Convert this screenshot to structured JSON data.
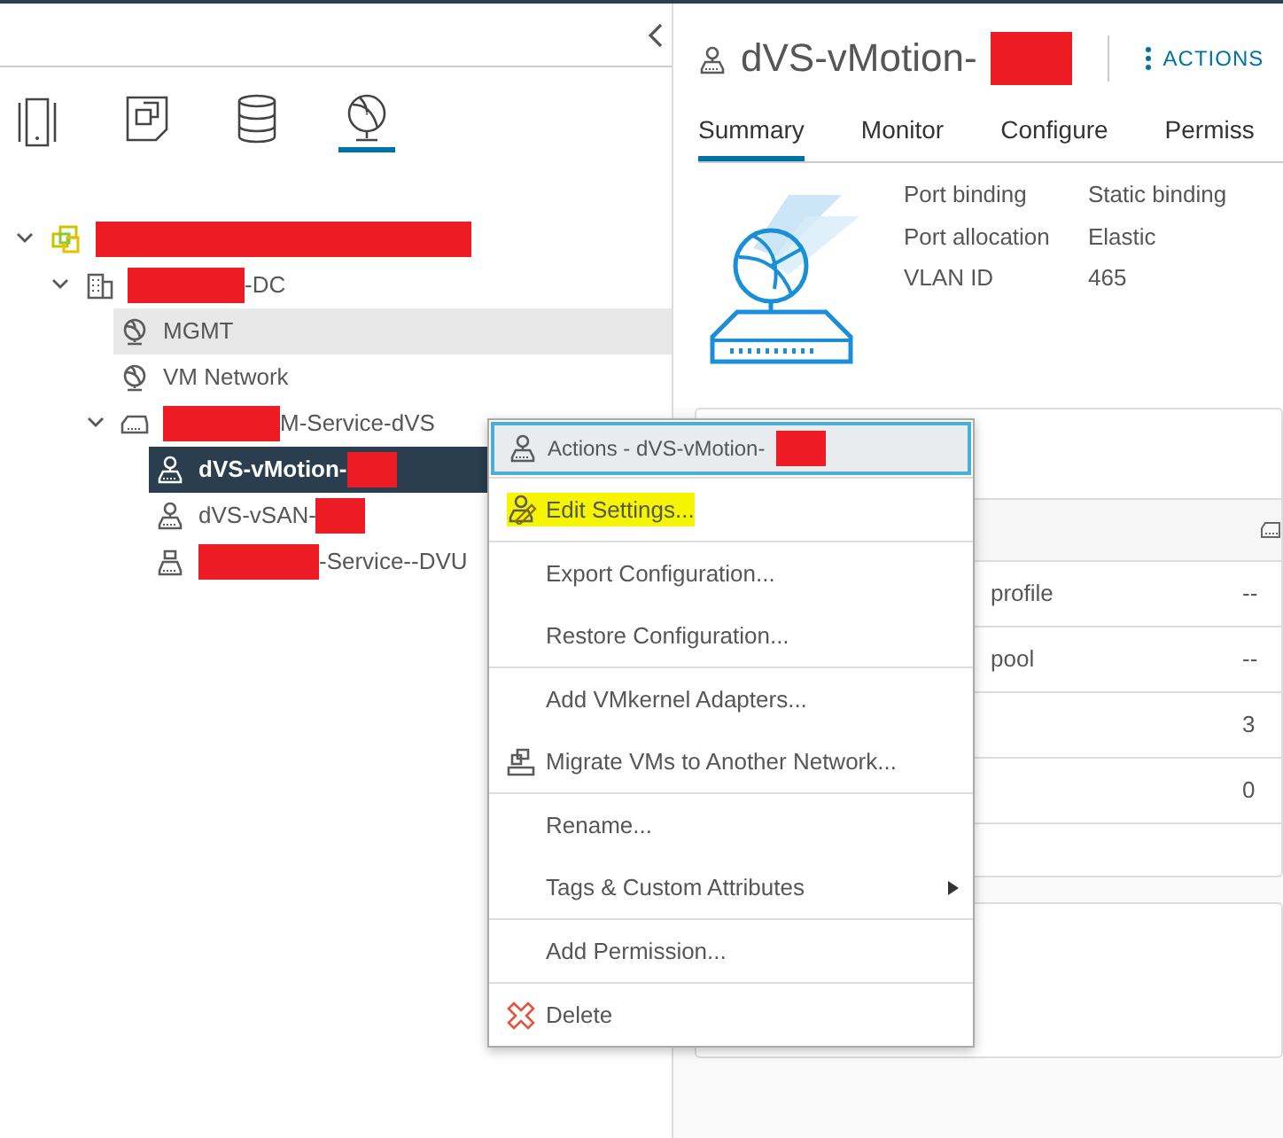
{
  "inventory_tabs": [
    {
      "kind": "hosts",
      "selected": false
    },
    {
      "kind": "vms",
      "selected": false
    },
    {
      "kind": "storage",
      "selected": false
    },
    {
      "kind": "networking",
      "selected": true
    }
  ],
  "tree": [
    {
      "kind": "vcenter",
      "redacted_before": true,
      "expanded": true,
      "selected": false,
      "hovered": false,
      "children": [
        {
          "kind": "datacenter",
          "label": "-DC",
          "redacted_before": true,
          "expanded": true,
          "selected": false,
          "hovered": false,
          "children": [
            {
              "kind": "network",
              "label": "MGMT",
              "selected": false,
              "hovered": true
            },
            {
              "kind": "network",
              "label": "VM Network",
              "selected": false,
              "hovered": false
            },
            {
              "kind": "switch",
              "label": "M-Service-dVS",
              "redacted_before": true,
              "expanded": true,
              "selected": false,
              "hovered": false,
              "children": [
                {
                  "kind": "portgroup",
                  "label": "dVS-vMotion-",
                  "redacted_after": true,
                  "selected": true,
                  "hovered": false
                },
                {
                  "kind": "portgroup",
                  "label": "dVS-vSAN-",
                  "redacted_after": true,
                  "selected": false,
                  "hovered": false
                },
                {
                  "kind": "uplink",
                  "label": "-Service--DVU",
                  "redacted_before": true,
                  "selected": false,
                  "hovered": false
                }
              ]
            }
          ]
        }
      ]
    }
  ],
  "object": {
    "title": "dVS-vMotion-",
    "actions_label": "ACTIONS"
  },
  "object_tabs": [
    {
      "label": "Summary",
      "selected": true
    },
    {
      "label": "Monitor",
      "selected": false
    },
    {
      "label": "Configure",
      "selected": false
    },
    {
      "label": "Permiss",
      "selected": false
    }
  ],
  "properties": [
    {
      "label": "Port binding",
      "value": "Static binding"
    },
    {
      "label": "Port allocation",
      "value": "Elastic"
    },
    {
      "label": "VLAN ID",
      "value": "465"
    }
  ],
  "details_rows": [
    {
      "label": "profile",
      "value": "--"
    },
    {
      "label": "pool",
      "value": "--"
    },
    {
      "value": "3"
    },
    {
      "value": "0"
    }
  ],
  "menu": {
    "title": "Actions - dVS-vMotion-",
    "groups": [
      [
        {
          "kind": "edit",
          "label": "Edit Settings...",
          "highlighted": true
        }
      ],
      [
        {
          "kind": "plain",
          "label": "Export Configuration...",
          "highlighted": false
        },
        {
          "kind": "plain",
          "label": "Restore Configuration...",
          "highlighted": false
        }
      ],
      [
        {
          "kind": "plain",
          "label": "Add VMkernel Adapters...",
          "highlighted": false
        },
        {
          "kind": "migrate",
          "label": "Migrate VMs to Another Network...",
          "highlighted": false
        }
      ],
      [
        {
          "kind": "plain",
          "label": "Rename...",
          "highlighted": false
        },
        {
          "kind": "submenu",
          "label": "Tags & Custom Attributes",
          "highlighted": false
        }
      ],
      [
        {
          "kind": "plain",
          "label": "Add Permission...",
          "highlighted": false
        }
      ],
      [
        {
          "kind": "delete",
          "label": "Delete",
          "highlighted": false
        }
      ]
    ]
  }
}
